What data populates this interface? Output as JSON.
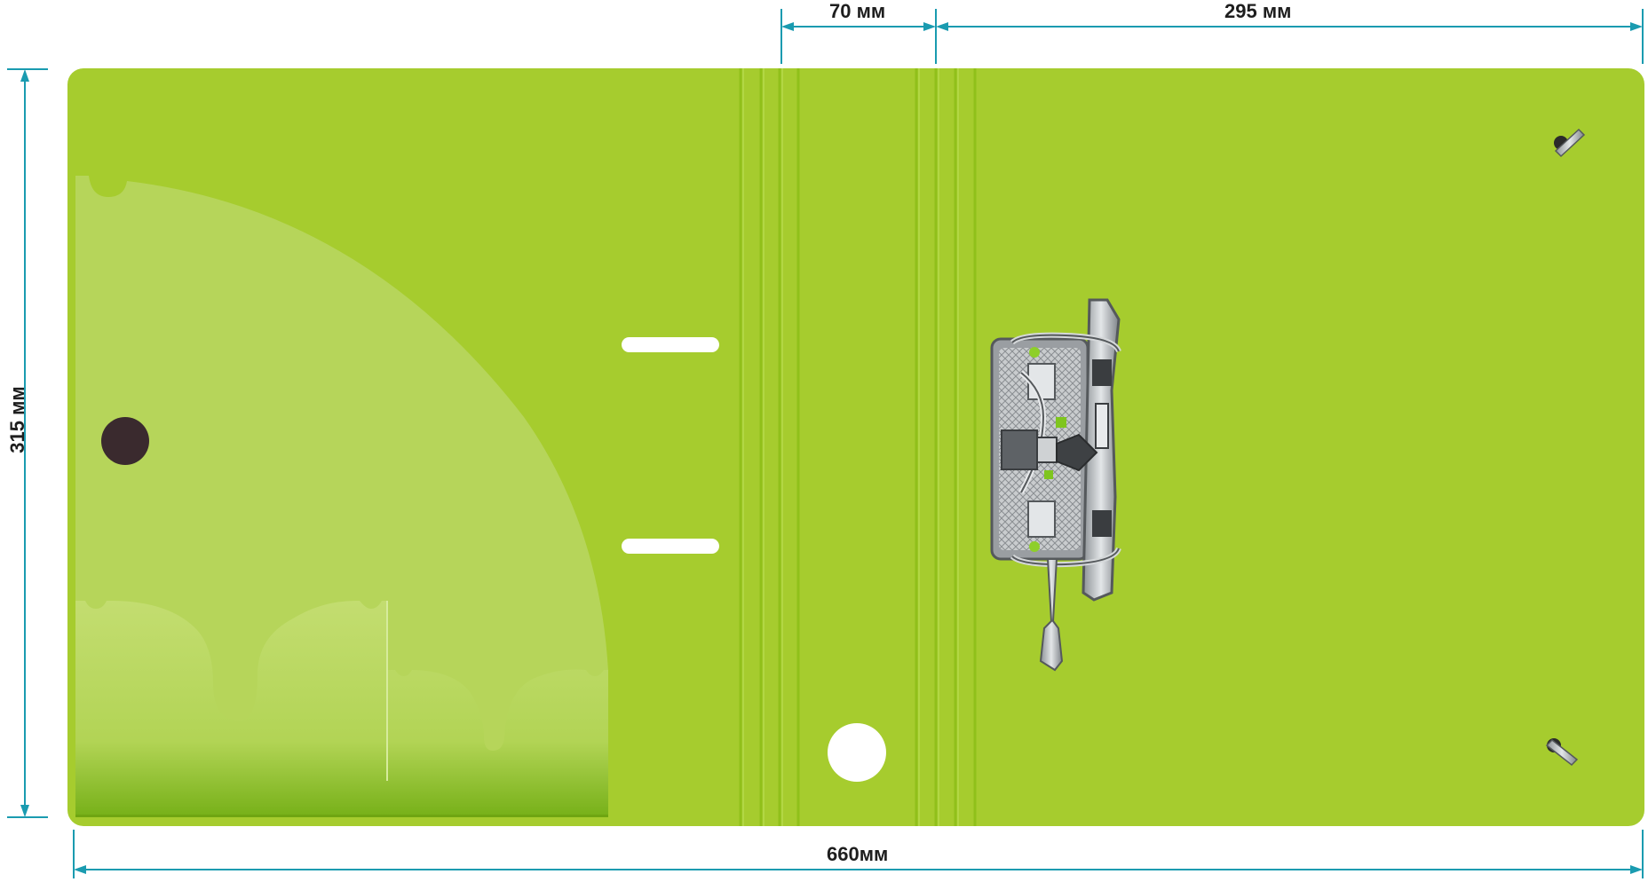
{
  "dimensions": {
    "spine_width": "70 мм",
    "cover_width": "295 мм",
    "total_width": "660мм",
    "height": "315 мм"
  },
  "colors": {
    "cover": "#a6cc2e",
    "cover_dark": "#8fbd22",
    "pocket_light": "#c6df78",
    "dimension_line": "#1a9bb0",
    "label_hole": "#ffffff",
    "ring_button": "#3a2a2e",
    "mechanism": "#b8bcc0"
  },
  "icons": {
    "mechanism": "lever-arch-mechanism-icon",
    "fastener": "rivet-icon",
    "button": "snap-button-icon"
  }
}
